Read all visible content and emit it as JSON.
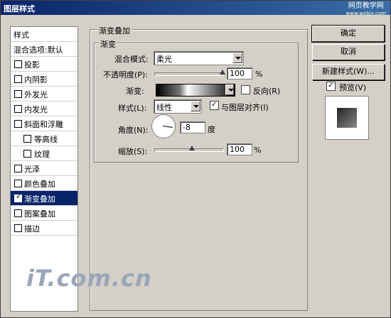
{
  "window": {
    "title": "图层样式",
    "watermark": "网页教学网",
    "watermark_sub": "www.webjx.com"
  },
  "sidebar": {
    "header": "样式",
    "blend_options": "混合选项:默认",
    "items": [
      {
        "label": "投影",
        "checked": false
      },
      {
        "label": "内阴影",
        "checked": false
      },
      {
        "label": "外发光",
        "checked": false
      },
      {
        "label": "内发光",
        "checked": false
      },
      {
        "label": "斜面和浮雕",
        "checked": false
      },
      {
        "label": "等高线",
        "checked": false
      },
      {
        "label": "纹理",
        "checked": false
      },
      {
        "label": "光泽",
        "checked": false
      },
      {
        "label": "颜色叠加",
        "checked": false
      },
      {
        "label": "渐变叠加",
        "checked": true
      },
      {
        "label": "图案叠加",
        "checked": false
      },
      {
        "label": "描边",
        "checked": false
      }
    ]
  },
  "gradient_overlay": {
    "group_title": "渐变叠加",
    "sub_title": "渐变",
    "blend_mode_label": "混合模式:",
    "blend_mode_value": "柔光",
    "opacity_label": "不透明度(P):",
    "opacity_value": "100",
    "opacity_unit": "%",
    "opacity_fraction": 1.0,
    "gradient_label": "渐变:",
    "reverse_label": "反向(R)",
    "style_label": "样式(L):",
    "style_value": "线性",
    "align_label": "与图层对齐(I)",
    "angle_label": "角度(N):",
    "angle_value": "-8",
    "angle_unit": "度",
    "scale_label": "缩放(S):",
    "scale_value": "100",
    "scale_unit": "%",
    "scale_fraction": 0.4
  },
  "buttons": {
    "ok": "确定",
    "cancel": "取消",
    "new_style": "新建样式(W)..."
  },
  "preview": {
    "label": "预览(V)",
    "checked": true
  },
  "logo_text": "iT.com.cn"
}
